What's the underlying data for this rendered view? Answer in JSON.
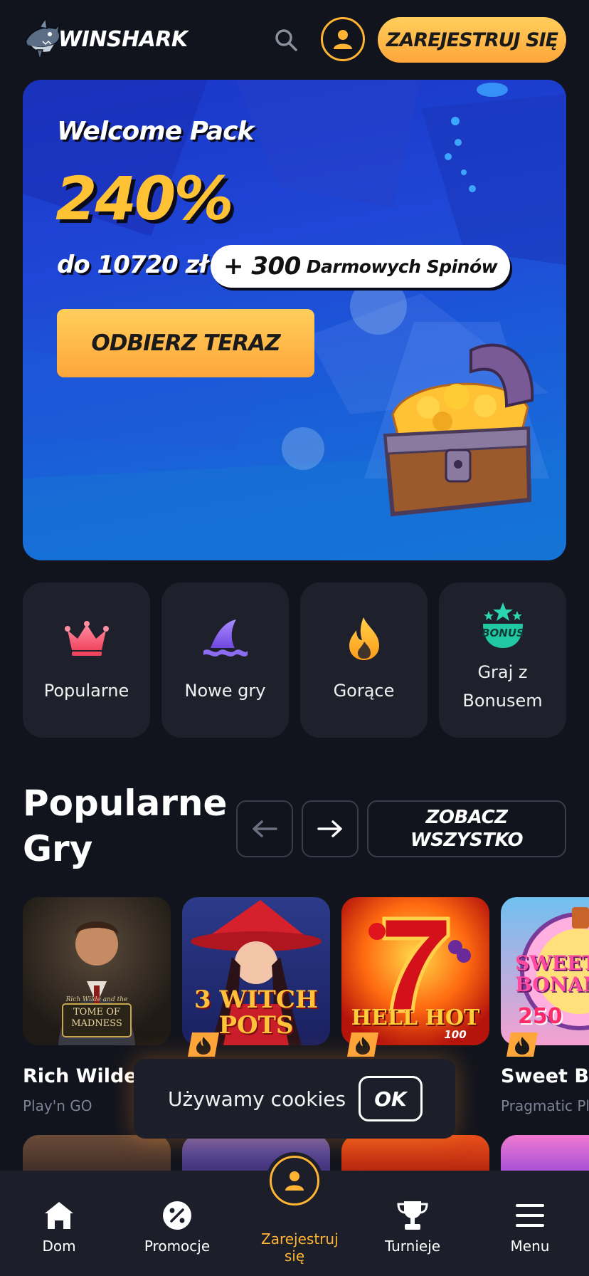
{
  "header": {
    "logo_text": "WINSHARK",
    "register_label": "ZAREJESTRUJ SIĘ",
    "accent_color": "#ffb533"
  },
  "hero": {
    "title": "Welcome Pack",
    "percent": "240%",
    "amount": "do 10720 zł",
    "spins_number": "+ 300",
    "spins_text": "Darmowych Spinów",
    "cta_label": "ODBIERZ TERAZ"
  },
  "categories": [
    {
      "label": "Popularne",
      "icon": "crown-icon"
    },
    {
      "label": "Nowe gry",
      "icon": "shark-fin-icon"
    },
    {
      "label": "Gorące",
      "icon": "flame-icon"
    },
    {
      "label": "Graj z Bonusem",
      "icon": "bonus-stars-icon",
      "badge": "BONUS"
    }
  ],
  "popular": {
    "title": "Popularne Gry",
    "see_all_label": "ZOBACZ WSZYSTKO",
    "games": [
      {
        "name": "Rich Wilde ar",
        "provider": "Play'n GO",
        "thumb_title": "TOME OF MADNESS",
        "thumb_sub": "Rich Wilde and the"
      },
      {
        "name": "",
        "provider": "",
        "thumb_title": "3 WITCH POTS"
      },
      {
        "name": "",
        "provider": "",
        "thumb_title": "HELL HOT",
        "thumb_sub": "100"
      },
      {
        "name": "Sweet Bor",
        "provider": "Pragmatic Pl",
        "thumb_title": "SWEET BONANZA",
        "thumb_sub": "250"
      }
    ]
  },
  "cookie": {
    "text": "Używamy cookies",
    "ok_label": "OK"
  },
  "bottom_nav": [
    {
      "label": "Dom",
      "icon": "home-icon"
    },
    {
      "label": "Promocje",
      "icon": "percent-icon"
    },
    {
      "label": "Zarejestruj się",
      "icon": "user-icon"
    },
    {
      "label": "Turnieje",
      "icon": "trophy-icon"
    },
    {
      "label": "Menu",
      "icon": "menu-icon"
    }
  ]
}
